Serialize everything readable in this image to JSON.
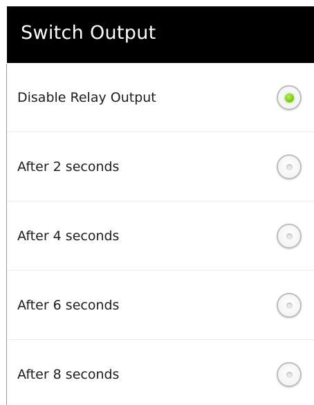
{
  "dialog": {
    "title": "Switch Output",
    "options": [
      {
        "label": "Disable Relay Output",
        "selected": true
      },
      {
        "label": "After 2 seconds",
        "selected": false
      },
      {
        "label": "After 4 seconds",
        "selected": false
      },
      {
        "label": "After 6 seconds",
        "selected": false
      },
      {
        "label": "After 8 seconds",
        "selected": false
      }
    ]
  },
  "colors": {
    "header_background": "#000000",
    "accent_selected": "#7dcf1a"
  }
}
